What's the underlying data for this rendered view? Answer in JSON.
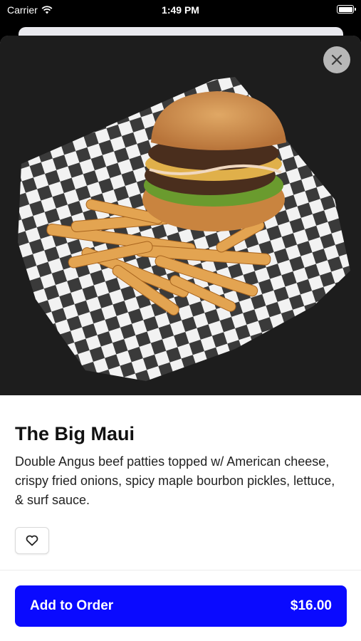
{
  "status_bar": {
    "carrier": "Carrier",
    "time": "1:49 PM"
  },
  "item": {
    "title": "The Big Maui",
    "description": "Double Angus beef patties topped w/ American cheese, crispy fried onions, spicy maple bourbon pickles, lettuce, & surf sauce."
  },
  "actions": {
    "add_label": "Add to Order",
    "price": "$16.00"
  },
  "icons": {
    "close": "close-icon",
    "favorite": "heart-icon",
    "wifi": "wifi-icon",
    "battery": "battery-icon"
  },
  "colors": {
    "primary": "#0a0aff",
    "peek": "#1fa775"
  }
}
